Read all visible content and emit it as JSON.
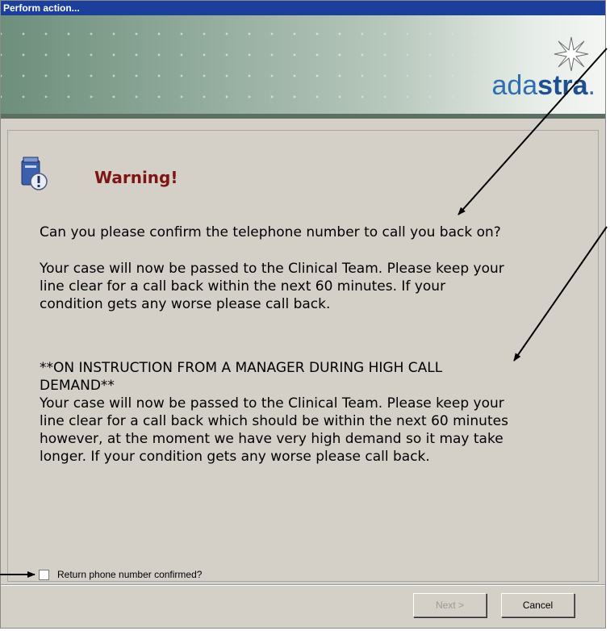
{
  "window": {
    "title": "Perform action..."
  },
  "banner": {
    "logo_regular": "ada",
    "logo_bold": "stra",
    "logo_dot": "."
  },
  "warning": {
    "title": "Warning!",
    "paragraphs": [
      "Can you please confirm the telephone number to call you back on?",
      "Your case will now be passed to the Clinical Team. Please keep your\nline clear for a call back within the next 60 minutes. If your\ncondition gets any worse please call back.",
      "**ON INSTRUCTION FROM A MANAGER DURING HIGH CALL\nDEMAND**\nYour case will now be passed to the Clinical Team. Please keep your\nline clear for a call back which should be within the next 60 minutes\nhowever, at the moment we have very high demand so it may take\nlonger. If your condition gets any worse please call back."
    ]
  },
  "confirm_checkbox": {
    "label": "Return phone number confirmed?",
    "checked": false
  },
  "buttons": {
    "next": "Next >",
    "cancel": "Cancel",
    "next_enabled": false
  },
  "colors": {
    "title_bar": "#1b3f9a",
    "warning_title": "#7f1414",
    "logo": "#2f6fb1",
    "dialog_bg": "#d4d0c8"
  },
  "icons": {
    "banner": "adastra-star-logo",
    "warning": "warning-info-icon"
  }
}
